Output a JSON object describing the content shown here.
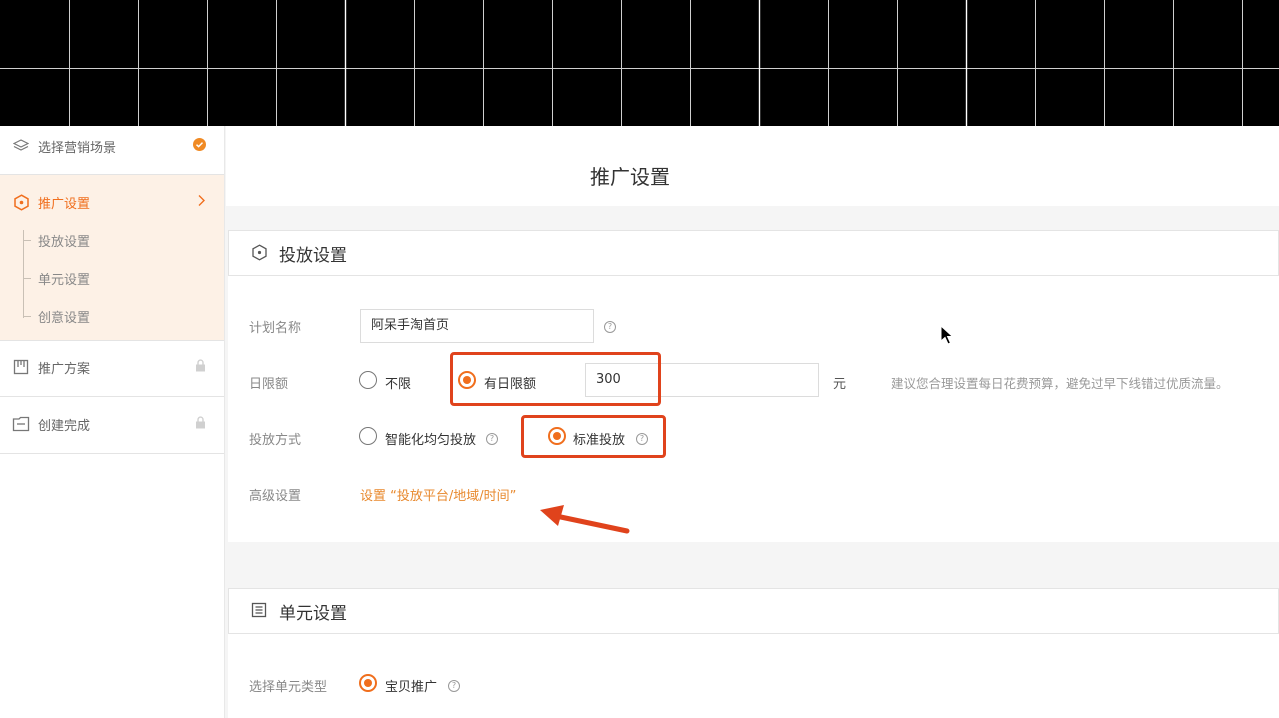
{
  "sidebar": {
    "items": [
      {
        "label": "选择营销场景",
        "icon": "layers-icon",
        "status": "done"
      },
      {
        "label": "推广设置",
        "icon": "hexagon-icon",
        "active": true
      },
      {
        "label": "推广方案",
        "icon": "plan-icon",
        "locked": true
      },
      {
        "label": "创建完成",
        "icon": "finish-icon",
        "locked": true
      }
    ],
    "sub_items": [
      "投放设置",
      "单元设置",
      "创意设置"
    ]
  },
  "page_title": "推广设置",
  "delivery_section": {
    "title": "投放设置",
    "plan_name_label": "计划名称",
    "plan_name_value": "阿呆手淘首页",
    "daily_limit_label": "日限额",
    "daily_limit_options": [
      "不限",
      "有日限额"
    ],
    "daily_limit_selected": "有日限额",
    "daily_limit_value": "300",
    "currency_unit": "元",
    "budget_hint": "建议您合理设置每日花费预算，避免过早下线错过优质流量。",
    "delivery_method_label": "投放方式",
    "delivery_method_options": [
      "智能化均匀投放",
      "标准投放"
    ],
    "delivery_method_selected": "标准投放",
    "advanced_label": "高级设置",
    "advanced_link": "设置 “投放平台/地域/时间”"
  },
  "unit_section": {
    "title": "单元设置",
    "unit_type_label": "选择单元类型",
    "unit_type_option": "宝贝推广"
  },
  "colors": {
    "accent": "#f06e1d",
    "link": "#e8892e",
    "highlight_box": "#e0431c",
    "active_bg": "#fdf1e6",
    "done_badge": "#f08a24"
  }
}
